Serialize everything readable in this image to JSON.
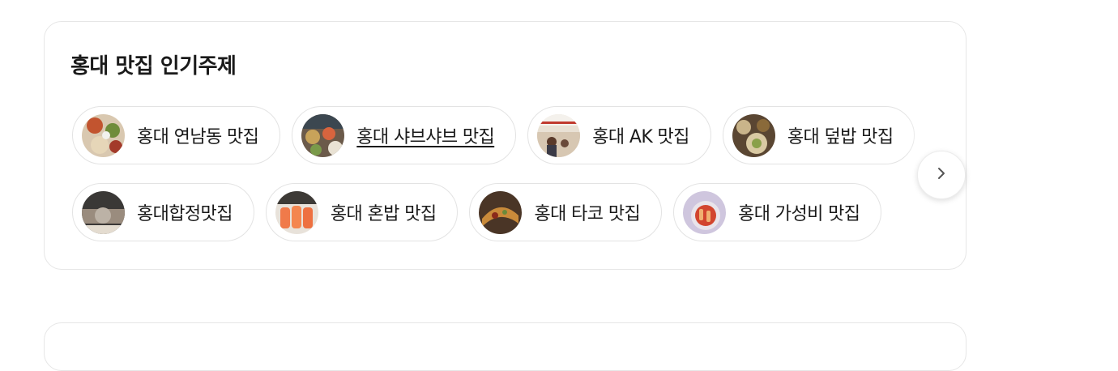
{
  "section": {
    "title": "홍대 맛집 인기주제"
  },
  "chips_row1": [
    {
      "label": "홍대 연남동 맛집",
      "thumb": "food-platter-photo"
    },
    {
      "label": "홍대 샤브샤브 맛집",
      "thumb": "shabu-buffet-photo"
    },
    {
      "label": "홍대 AK 맛집",
      "thumb": "storefront-photo"
    },
    {
      "label": "홍대 덮밥 맛집",
      "thumb": "rice-bowl-photo"
    }
  ],
  "chips_row2": [
    {
      "label": "홍대합정맛집",
      "thumb": "grill-photo"
    },
    {
      "label": "홍대 혼밥 맛집",
      "thumb": "salmon-photo"
    },
    {
      "label": "홍대 타코 맛집",
      "thumb": "taco-photo"
    },
    {
      "label": "홍대 가성비 맛집",
      "thumb": "tteokbokki-photo"
    }
  ],
  "next_button": {
    "icon": "chevron-right-icon"
  },
  "colors": {
    "border": "#e6e6e6",
    "chip_border": "#e3e3e3",
    "text": "#1a1a1a"
  }
}
